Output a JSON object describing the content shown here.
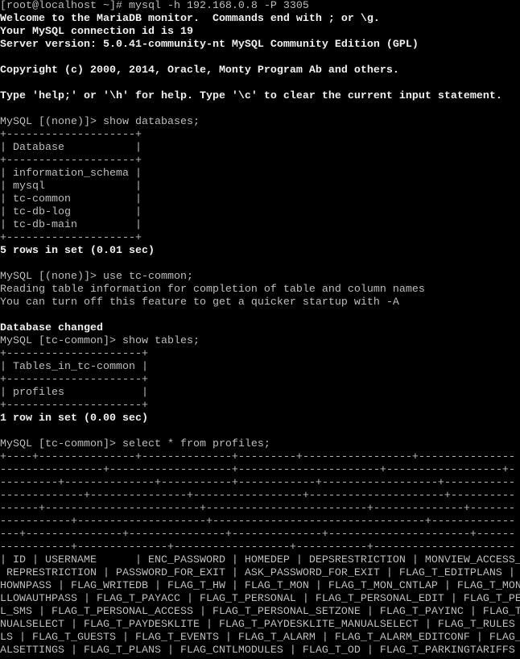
{
  "terminal": {
    "background": "#000000",
    "foreground": "#bdbdbd",
    "bold_foreground": "#f0f0f0",
    "lines": [
      {
        "text": "[root@localhost ~]# mysql -h 192.168.0.8 -P 3305",
        "bold": false
      },
      {
        "text": "Welcome to the MariaDB monitor.  Commands end with ; or \\g.",
        "bold": true
      },
      {
        "text": "Your MySQL connection id is 19",
        "bold": true
      },
      {
        "text": "Server version: 5.0.41-community-nt MySQL Community Edition (GPL)",
        "bold": true
      },
      {
        "text": "",
        "bold": false
      },
      {
        "text": "Copyright (c) 2000, 2014, Oracle, Monty Program Ab and others.",
        "bold": true
      },
      {
        "text": "",
        "bold": false
      },
      {
        "text": "Type 'help;' or '\\h' for help. Type '\\c' to clear the current input statement.",
        "bold": true
      },
      {
        "text": "",
        "bold": false
      },
      {
        "text": "MySQL [(none)]> show databases;",
        "bold": false
      },
      {
        "text": "+--------------------+",
        "bold": false
      },
      {
        "text": "| Database           |",
        "bold": false
      },
      {
        "text": "+--------------------+",
        "bold": false
      },
      {
        "text": "| information_schema |",
        "bold": false
      },
      {
        "text": "| mysql              |",
        "bold": false
      },
      {
        "text": "| tc-common          |",
        "bold": false
      },
      {
        "text": "| tc-db-log          |",
        "bold": false
      },
      {
        "text": "| tc-db-main         |",
        "bold": false
      },
      {
        "text": "+--------------------+",
        "bold": false
      },
      {
        "text": "5 rows in set (0.01 sec)",
        "bold": true
      },
      {
        "text": "",
        "bold": false
      },
      {
        "text": "MySQL [(none)]> use tc-common;",
        "bold": false
      },
      {
        "text": "Reading table information for completion of table and column names",
        "bold": false
      },
      {
        "text": "You can turn off this feature to get a quicker startup with -A",
        "bold": false
      },
      {
        "text": "",
        "bold": false
      },
      {
        "text": "Database changed",
        "bold": true
      },
      {
        "text": "MySQL [tc-common]> show tables;",
        "bold": false
      },
      {
        "text": "+---------------------+",
        "bold": false
      },
      {
        "text": "| Tables_in_tc-common |",
        "bold": false
      },
      {
        "text": "+---------------------+",
        "bold": false
      },
      {
        "text": "| profiles            |",
        "bold": false
      },
      {
        "text": "+---------------------+",
        "bold": false
      },
      {
        "text": "1 row in set (0.00 sec)",
        "bold": true
      },
      {
        "text": "",
        "bold": false
      },
      {
        "text": "MySQL [tc-common]> select * from profiles;",
        "bold": false
      },
      {
        "text": "+----+---------------+--------------+---------+-----------------+---------------",
        "bold": false
      },
      {
        "text": "----------------+-------------------+----------------------+------------------+-",
        "bold": false
      },
      {
        "text": "---------+--------------+-----------+------------+------------------+-----------",
        "bold": false
      },
      {
        "text": "-------------+---------------+-----------------+---------------------+----------",
        "bold": false
      },
      {
        "text": "------+------------------------+-------------------------+--------------+-------",
        "bold": false
      },
      {
        "text": "-----------+--------------------+---------------------------------+-------------",
        "bold": false
      },
      {
        "text": "---+---------------+---------------+--------------+----------------------+------",
        "bold": false
      },
      {
        "text": "-----------+--------------+------------------+-----------+----------------------",
        "bold": false
      },
      {
        "text": "| ID | USERNAME      | ENC_PASSWORD | HOMEDEP | DEPSRESTRICTION | MONVIEW_ACCESS_",
        "bold": false
      },
      {
        "text": " REPRESTRICTION | PASSWORD_FOR_EXIT | ASK_PASSWORD_FOR_EXIT | FLAG_T_EDITPLANS | ",
        "bold": false
      },
      {
        "text": "HOWNPASS | FLAG_WRITEDB | FLAG_T_HW | FLAG_T_MON | FLAG_T_MON_CNTLAP | FLAG_T_MON",
        "bold": false
      },
      {
        "text": "LLOWAUTHPASS | FLAG_T_PAYACC | FLAG_T_PERSONAL | FLAG_T_PERSONAL_EDIT | FLAG_T_PE",
        "bold": false
      },
      {
        "text": "L_SMS | FLAG_T_PERSONAL_ACCESS | FLAG_T_PERSONAL_SETZONE | FLAG_T_PAYINC | FLAG_T",
        "bold": false
      },
      {
        "text": "NUALSELECT | FLAG_T_PAYDESKLITE | FLAG_T_PAYDESKLITE_MANUALSELECT | FLAG_T_RULES ",
        "bold": false
      },
      {
        "text": "LS | FLAG_T_GUESTS | FLAG_T_EVENTS | FLAG_T_ALARM | FLAG_T_ALARM_EDITCONF | FLAG_",
        "bold": false
      },
      {
        "text": "ALSETTINGS | FLAG_T_PLANS | FLAG_CNTLMODULES | FLAG_T_OD | FLAG_T_PARKINGTARIFFS ",
        "bold": false
      }
    ]
  }
}
